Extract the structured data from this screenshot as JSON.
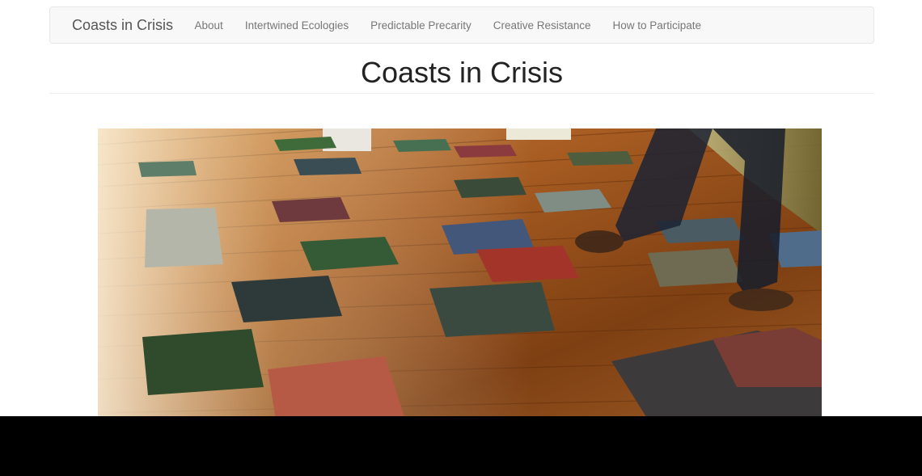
{
  "navbar": {
    "brand": "Coasts in Crisis",
    "links": [
      "About",
      "Intertwined Ecologies",
      "Predictable Precarity",
      "Creative Resistance",
      "How to Participate"
    ]
  },
  "page": {
    "title": "Coasts in Crisis"
  },
  "colors": {
    "navbar_bg": "#f8f8f8",
    "floor_wood": "#a0561f",
    "overlay_bar": "#000000"
  }
}
